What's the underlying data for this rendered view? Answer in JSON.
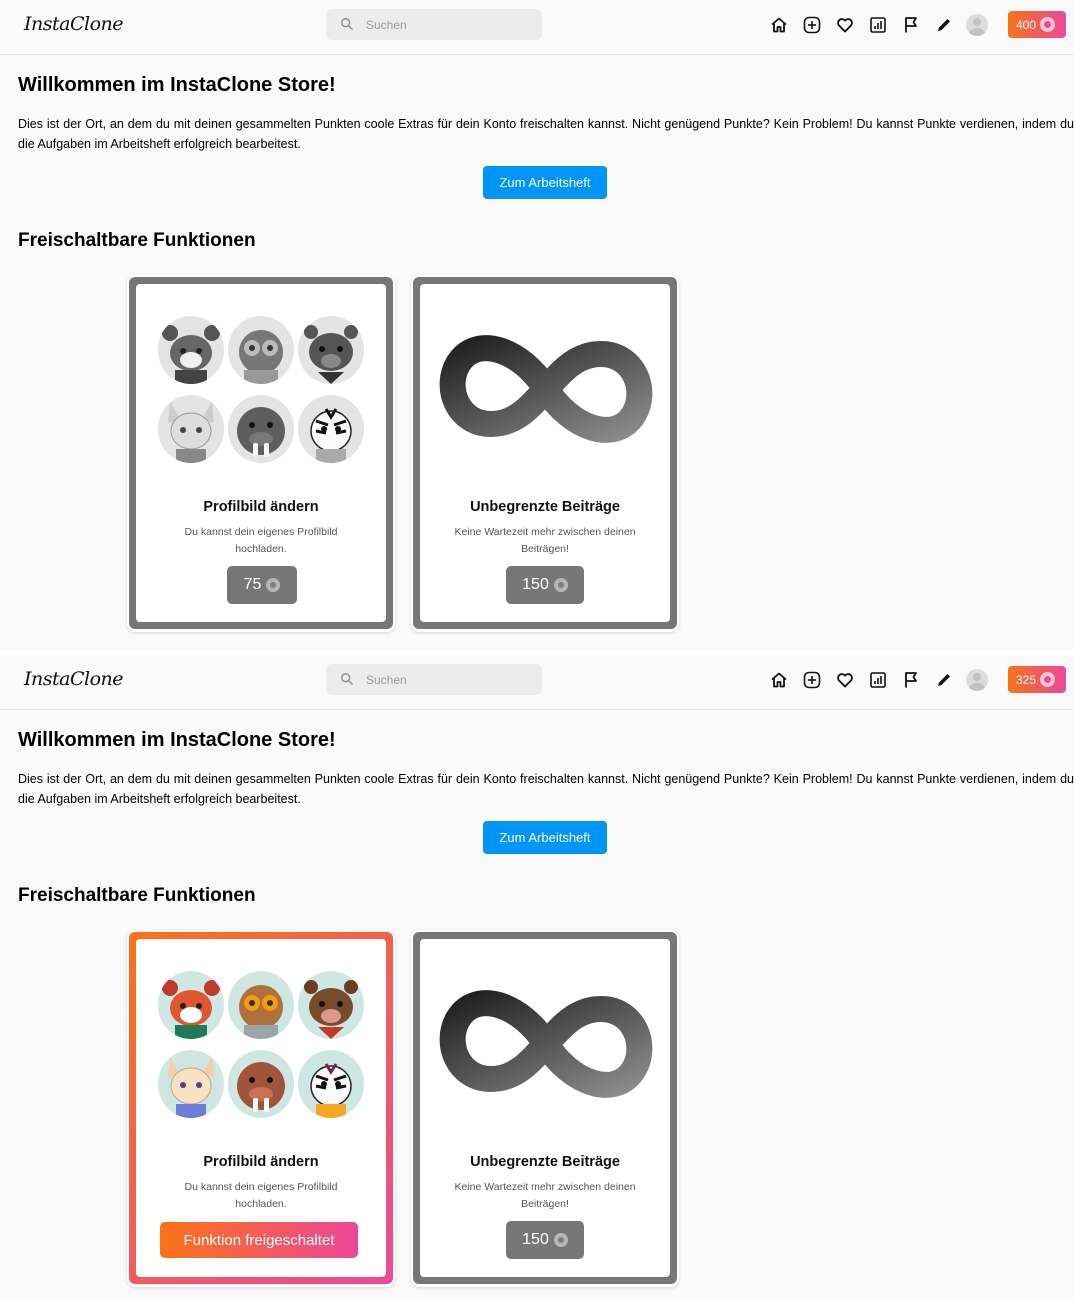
{
  "colors": {
    "primary": "#0095f6",
    "accent_gradient_start": "#f97316",
    "accent_gradient_end": "#ec4899",
    "locked_gray": "#777777"
  },
  "states": [
    {
      "header": {
        "logo": "InstaClone",
        "search_placeholder": "Suchen",
        "nav_icons": [
          "home-icon",
          "plus-square-icon",
          "heart-icon",
          "chart-icon",
          "flag-icon",
          "pencil-icon",
          "avatar"
        ],
        "points": "400"
      },
      "welcome_title": "Willkommen im InstaClone Store!",
      "intro": "Dies ist der Ort, an dem du mit deinen gesammelten Punkten coole Extras für dein Konto freischalten kannst. Nicht genügend Punkte? Kein Problem! Du kannst Punkte verdienen, indem du die Aufgaben im Arbeitsheft erfolgreich bearbeitest.",
      "workbook_button": "Zum Arbeitsheft",
      "section_title": "Freischaltbare Funktionen",
      "cards": [
        {
          "title": "Profilbild ändern",
          "description": "Du kannst dein eigenes Profilbild hochladen.",
          "price": "75",
          "locked": true
        },
        {
          "title": "Unbegrenzte Beiträge",
          "description": "Keine Wartezeit mehr zwischen deinen Beiträgen!",
          "price": "150",
          "locked": true
        }
      ]
    },
    {
      "header": {
        "logo": "InstaClone",
        "search_placeholder": "Suchen",
        "nav_icons": [
          "home-icon",
          "plus-square-icon",
          "heart-icon",
          "chart-icon",
          "flag-icon",
          "pencil-icon",
          "avatar"
        ],
        "points": "325"
      },
      "welcome_title": "Willkommen im InstaClone Store!",
      "intro": "Dies ist der Ort, an dem du mit deinen gesammelten Punkten coole Extras für dein Konto freischalten kannst. Nicht genügend Punkte? Kein Problem! Du kannst Punkte verdienen, indem du die Aufgaben im Arbeitsheft erfolgreich bearbeitest.",
      "workbook_button": "Zum Arbeitsheft",
      "section_title": "Freischaltbare Funktionen",
      "cards": [
        {
          "title": "Profilbild ändern",
          "description": "Du kannst dein eigenes Profilbild hochladen.",
          "unlocked_label": "Funktion freigeschaltet",
          "locked": false
        },
        {
          "title": "Unbegrenzte Beiträge",
          "description": "Keine Wartezeit mehr zwischen deinen Beiträgen!",
          "price": "150",
          "locked": true
        }
      ]
    }
  ]
}
